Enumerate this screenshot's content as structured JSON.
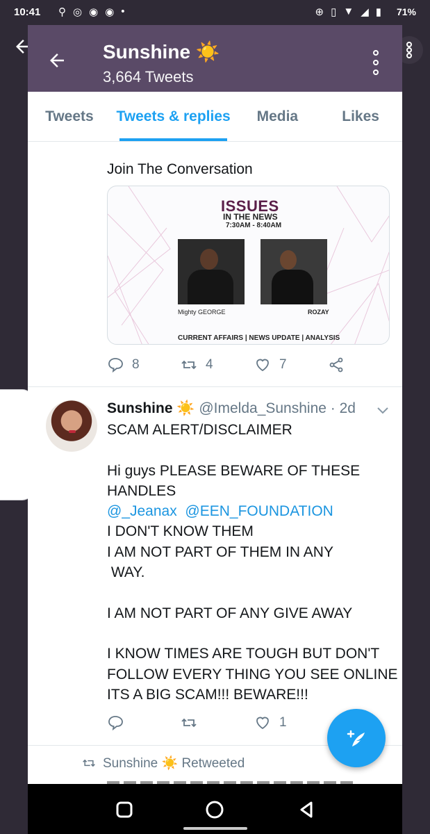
{
  "status_bar": {
    "time": "10:41",
    "battery": "71%"
  },
  "header": {
    "name": "Sunshine ☀️",
    "tweet_count": "3,664 Tweets"
  },
  "tabs": [
    {
      "label": "Tweets",
      "active": false
    },
    {
      "label": "Tweets & replies",
      "active": true
    },
    {
      "label": "Media",
      "active": false
    },
    {
      "label": "Likes",
      "active": false
    }
  ],
  "tweet1": {
    "text": "Join The Conversation",
    "media": {
      "title_line1": "ISSUES",
      "title_line2": "IN THE NEWS",
      "time": "7:30AM - 8:40AM",
      "caption_left": "Mighty GEORGE",
      "caption_right": "ROZAY",
      "footer": "CURRENT AFFAIRS | NEWS UPDATE | ANALYSIS"
    },
    "replies": "8",
    "retweets": "4",
    "likes": "7"
  },
  "tweet2": {
    "name": "Sunshine ☀️",
    "handle_time": "@Imelda_Sunshine · 2d",
    "lines": [
      "SCAM ALERT/DISCLAIMER",
      "",
      "Hi guys PLEASE BEWARE OF THESE",
      "HANDLES",
      "",
      "I DON'T KNOW THEM",
      "I AM NOT PART OF THEM IN ANY",
      " WAY.",
      "",
      "I AM NOT PART OF ANY GIVE AWAY",
      "",
      "I KNOW TIMES ARE TOUGH BUT DON'T",
      "FOLLOW EVERY THING YOU SEE ONLINE",
      "ITS A BIG SCAM!!! BEWARE!!!"
    ],
    "mention1": "@_Jeanax",
    "mention2": "@EEN_FOUNDATION",
    "replies": "",
    "retweets": "",
    "likes": "1"
  },
  "retweet_row": {
    "label": "Sunshine ☀️ Retweeted"
  },
  "colors": {
    "accent": "#1da1f2",
    "header": "#5a4a67",
    "muted": "#657786"
  },
  "icons": [
    "back-arrow-icon",
    "more-vert-icon",
    "reply-icon",
    "retweet-icon",
    "like-icon",
    "share-icon",
    "chevron-down-icon",
    "compose-icon",
    "square-nav-icon",
    "home-circle-icon",
    "back-triangle-icon"
  ]
}
